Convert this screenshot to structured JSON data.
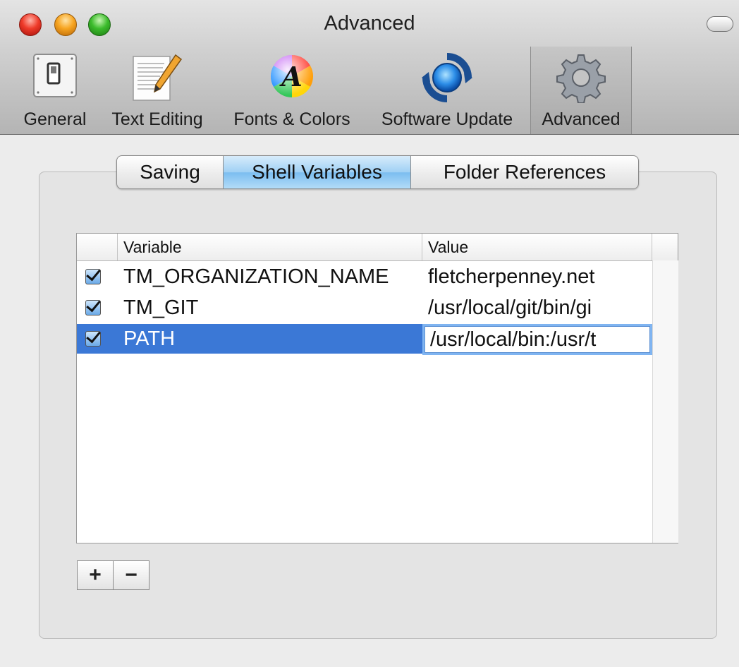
{
  "window": {
    "title": "Advanced"
  },
  "toolbar": {
    "items": [
      {
        "label": "General",
        "icon": "switch-icon"
      },
      {
        "label": "Text Editing",
        "icon": "document-pencil-icon"
      },
      {
        "label": "Fonts & Colors",
        "icon": "font-color-wheel-icon"
      },
      {
        "label": "Software Update",
        "icon": "update-arrows-icon"
      },
      {
        "label": "Advanced",
        "icon": "gear-icon",
        "selected": true
      }
    ]
  },
  "tabs": [
    {
      "label": "Saving"
    },
    {
      "label": "Shell Variables",
      "active": true
    },
    {
      "label": "Folder References"
    }
  ],
  "table": {
    "columns": {
      "variable": "Variable",
      "value": "Value"
    },
    "rows": [
      {
        "enabled": true,
        "variable": "TM_ORGANIZATION_NAME",
        "value": "fletcherpenney.net"
      },
      {
        "enabled": true,
        "variable": "TM_GIT",
        "value": "/usr/local/git/bin/gi"
      },
      {
        "enabled": true,
        "variable": "PATH",
        "value": "/usr/local/bin:/usr/t",
        "selected": true,
        "editing": true
      }
    ]
  },
  "buttons": {
    "add": "+",
    "remove": "−"
  },
  "colors": {
    "selection": "#3b78d6",
    "active_tab": "#9fd0f4",
    "edit_focus": "#7fb4f1"
  }
}
